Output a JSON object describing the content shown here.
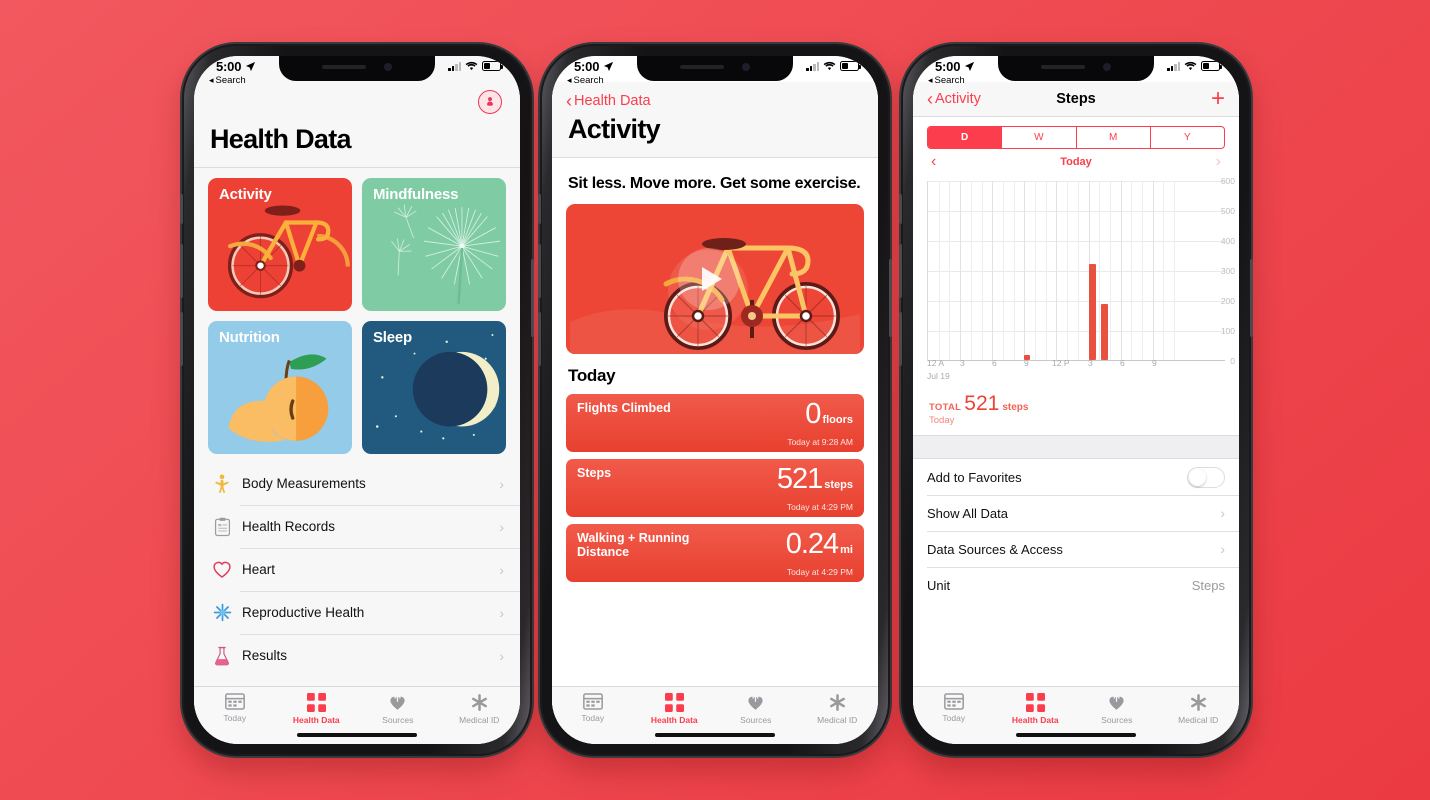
{
  "theme": {
    "accent": "#FC3D4D",
    "card_activity": "#EE4136",
    "card_mindfulness": "#7FCBA4",
    "card_nutrition": "#93CBE8",
    "card_sleep": "#215A7E",
    "background_from": "#F2585F",
    "background_to": "#EB3A42"
  },
  "status_bar": {
    "time": "5:00",
    "back_label": "Search",
    "location_icon": "location-arrow-icon"
  },
  "tabs": [
    {
      "label": "Today",
      "icon": "calendar-icon",
      "active": false
    },
    {
      "label": "Health Data",
      "icon": "health-data-grid-icon",
      "active": true
    },
    {
      "label": "Sources",
      "icon": "heart-plug-icon",
      "active": false
    },
    {
      "label": "Medical ID",
      "icon": "asterisk-icon",
      "active": false
    }
  ],
  "phone1": {
    "avatar_icon": "profile-icon",
    "title": "Health Data",
    "cards": [
      {
        "label": "Activity",
        "art": "bicycle-illustration"
      },
      {
        "label": "Mindfulness",
        "art": "dandelion-illustration"
      },
      {
        "label": "Nutrition",
        "art": "peach-illustration"
      },
      {
        "label": "Sleep",
        "art": "moon-illustration"
      }
    ],
    "rows": [
      {
        "label": "Body Measurements",
        "icon": "body-figure-icon"
      },
      {
        "label": "Health Records",
        "icon": "clipboard-icon"
      },
      {
        "label": "Heart",
        "icon": "heart-icon"
      },
      {
        "label": "Reproductive Health",
        "icon": "snowflake-icon"
      },
      {
        "label": "Results",
        "icon": "flask-icon"
      }
    ]
  },
  "phone2": {
    "back_label": "Health Data",
    "title": "Activity",
    "subtitle": "Sit less. Move more. Get some exercise.",
    "hero": {
      "art": "bicycle-illustration",
      "play_icon": "play-icon"
    },
    "section_title": "Today",
    "metrics": [
      {
        "label": "Flights Climbed",
        "value": "0",
        "unit": "floors",
        "time": "Today at 9:28 AM"
      },
      {
        "label": "Steps",
        "value": "521",
        "unit": "steps",
        "time": "Today at 4:29 PM"
      },
      {
        "label": "Walking + Running Distance",
        "value": "0.24",
        "unit": "mi",
        "time": "Today at 4:29 PM"
      }
    ]
  },
  "phone3": {
    "back_label": "Activity",
    "title": "Steps",
    "add_icon": "plus-icon",
    "segments": [
      {
        "label": "D",
        "active": true
      },
      {
        "label": "W",
        "active": false
      },
      {
        "label": "M",
        "active": false
      },
      {
        "label": "Y",
        "active": false
      }
    ],
    "date_label": "Today",
    "prev_icon": "chevron-left-icon",
    "next_icon": "chevron-right-icon",
    "total": {
      "key": "TOTAL",
      "value": "521",
      "unit": "steps",
      "sub": "Today"
    },
    "settings": [
      {
        "label": "Add to Favorites",
        "control": "toggle",
        "value": ""
      },
      {
        "label": "Show All Data",
        "control": "chevron",
        "value": ""
      },
      {
        "label": "Data Sources & Access",
        "control": "chevron",
        "value": ""
      },
      {
        "label": "Unit",
        "control": "value",
        "value": "Steps"
      }
    ]
  },
  "chart_data": {
    "type": "bar",
    "title": "Steps",
    "xlabel": "",
    "ylabel": "",
    "date": "Jul 19",
    "ylim": [
      0,
      600
    ],
    "yticks": [
      0,
      100,
      200,
      300,
      400,
      500,
      600
    ],
    "xticks": [
      "12 A",
      "3",
      "6",
      "9",
      "12 P",
      "3",
      "6",
      "9"
    ],
    "grid": true,
    "bar_color": "#E8503F",
    "total": 521,
    "unit": "steps",
    "x": [
      "9 AM",
      "3 PM",
      "4 PM"
    ],
    "values": [
      16,
      320,
      185
    ]
  }
}
